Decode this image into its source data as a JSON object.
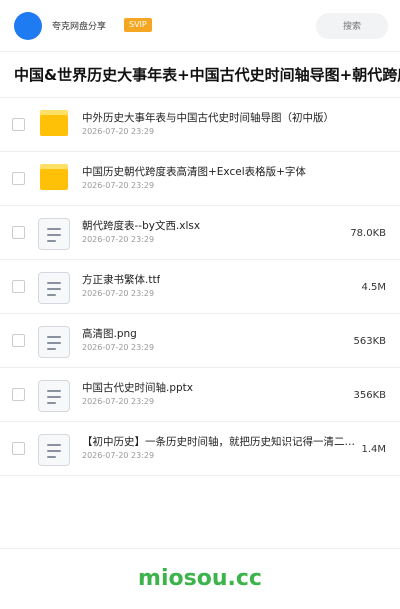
{
  "header": {
    "share_name": "夸克网盘分享",
    "badge": "SVIP",
    "search_placeholder": "搜索"
  },
  "title": "中国&世界历史大事年表+中国古代史时间轴导图+朝代跨度表",
  "files": [
    {
      "name": "中外历史大事年表与中国古代史时间轴导图（初中版）",
      "date": "2026-07-20 23:29",
      "size": "",
      "icon": "folder-icon"
    },
    {
      "name": "中国历史朝代跨度表高清图+Excel表格版+字体",
      "date": "2026-07-20 23:29",
      "size": "",
      "icon": "folder-icon"
    },
    {
      "name": "朝代跨度表--by文西.xlsx",
      "date": "2026-07-20 23:29",
      "size": "78.0KB",
      "icon": "file-icon"
    },
    {
      "name": "方正隶书繁体.ttf",
      "date": "2026-07-20 23:29",
      "size": "4.5M",
      "icon": "file-icon"
    },
    {
      "name": "高清图.png",
      "date": "2026-07-20 23:29",
      "size": "563KB",
      "icon": "file-icon"
    },
    {
      "name": "中国古代史时间轴.pptx",
      "date": "2026-07-20 23:29",
      "size": "356KB",
      "icon": "file-icon"
    },
    {
      "name": "【初中历史】一条历史时间轴，就把历史知识记得一清二楚.pdf",
      "date": "2026-07-20 23:29",
      "size": "1.4M",
      "icon": "file-icon"
    }
  ],
  "watermark": "miosou.cc"
}
